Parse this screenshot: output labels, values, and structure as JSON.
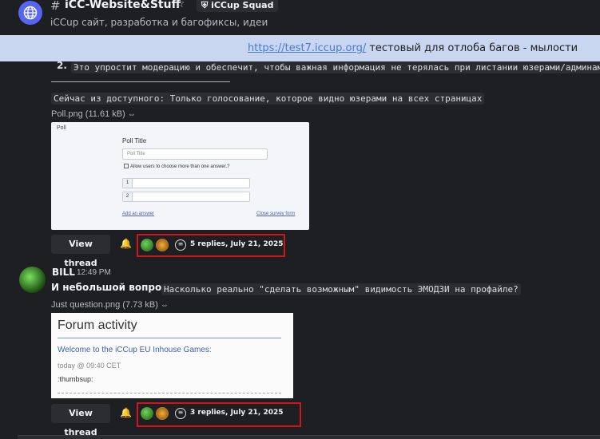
{
  "header": {
    "channel_title": "iCC-Website&Stuff",
    "squad_label": "iCCup Squad",
    "subtitle": "iCCup сайт, разработка и багофиксы, идеи"
  },
  "banner": {
    "link": "https://test7.iccup.org/",
    "text": " тестовый для отлоба багов - мылости просим"
  },
  "message1": {
    "list_number": "2.",
    "code_line": "Это упростит модерацию и обеспечит, чтобы важная информация не терялась при листании юзерами/админами",
    "code_line2": "Сейчас из доступного: Только голосование, которое видно юзерами на всех страницах",
    "attachment": "Poll.png (11.61 kB)",
    "poll": {
      "corner": "Poll",
      "label": "Poll Title",
      "placeholder": "Poll Title",
      "checkbox": "Allow users to choose more than one answer.?",
      "opt1": "1",
      "opt2": "2",
      "add": "Add an answer",
      "close": "Close survey form"
    },
    "thread": {
      "button": "View thread",
      "replies": "5 replies, July 21, 2025"
    }
  },
  "message2": {
    "author": "BILL",
    "time": "12:49 PM",
    "bold": "И небольшой вопрос:",
    "code": "Насколько реально \"сделать возможным\" видимость ЭМОДЗИ на профайле?",
    "attachment": "Just question.png (7.73 kB)",
    "forum": {
      "title": "Forum activity",
      "welcome": "Welcome to the iCCup EU Inhouse Games:",
      "today": "today @ 09:40 CET",
      "thumb": ":thumbsup:"
    },
    "thread": {
      "button": "View thread",
      "replies": "3 replies, July 21, 2025"
    }
  }
}
